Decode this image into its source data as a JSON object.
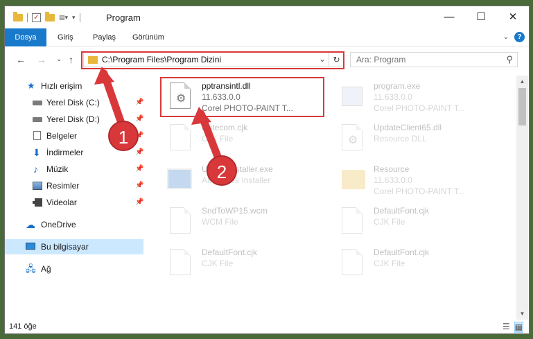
{
  "window": {
    "title": "Program",
    "minimize": "—",
    "maximize": "☐",
    "close": "✕"
  },
  "ribbon": {
    "tabs": [
      "Dosya",
      "Giriş",
      "Paylaş",
      "Görünüm"
    ],
    "expand": "⌄",
    "help": "?"
  },
  "nav": {
    "back": "←",
    "forward": "→",
    "recent": "⌄",
    "up": "↑",
    "path": "C:\\Program Files\\Program Dizini",
    "dropdown": "⌄",
    "refresh": "↻",
    "search_placeholder": "Ara: Program",
    "search_icon": "⚲"
  },
  "sidebar": {
    "items": [
      {
        "label": "Hızlı erişim",
        "icon": "star-icon",
        "pinned": false
      },
      {
        "label": "Yerel Disk (C:)",
        "icon": "disk-icon",
        "pinned": true
      },
      {
        "label": "Yerel Disk (D:)",
        "icon": "disk-icon",
        "pinned": true
      },
      {
        "label": "Belgeler",
        "icon": "documents-icon",
        "pinned": true
      },
      {
        "label": "İndirmeler",
        "icon": "download-icon",
        "pinned": true
      },
      {
        "label": "Müzik",
        "icon": "music-icon",
        "pinned": true
      },
      {
        "label": "Resimler",
        "icon": "pictures-icon",
        "pinned": true
      },
      {
        "label": "Videolar",
        "icon": "videos-icon",
        "pinned": true
      },
      {
        "label": "OneDrive",
        "icon": "onedrive-icon",
        "pinned": false
      },
      {
        "label": "Bu bilgisayar",
        "icon": "computer-icon",
        "pinned": false
      },
      {
        "label": "Ağ",
        "icon": "network-icon",
        "pinned": false
      }
    ],
    "pin_glyph": "📌"
  },
  "files": [
    {
      "name": "pptransintl.dll",
      "line2": "11.633.0.0",
      "line3": "Corel PHOTO-PAINT T...",
      "icon": "dll-icon"
    },
    {
      "name": "program.exe",
      "line2": "11.633.0.0",
      "line3": "Corel PHOTO-PAINT T...",
      "icon": "exe-icon"
    },
    {
      "name": "Ratecom.cjk",
      "line2": "CJK File",
      "line3": "",
      "icon": "file-icon"
    },
    {
      "name": "UpdateClient65.dll",
      "line2": "Resource DLL",
      "line3": "",
      "icon": "dll-icon"
    },
    {
      "name": "UpdateInstaller.exe",
      "line2": "Alternates Installer",
      "line3": "",
      "icon": "app-icon"
    },
    {
      "name": "Resource",
      "line2": "11.633.0.0",
      "line3": "Corel PHOTO-PAINT T...",
      "icon": "folder-icon"
    },
    {
      "name": "SndToWP15.wcm",
      "line2": "WCM File",
      "line3": "",
      "icon": "file-icon"
    },
    {
      "name": "DefaultFont.cjk",
      "line2": "CJK File",
      "line3": "",
      "icon": "file-icon"
    },
    {
      "name": "DefaultFont.cjk",
      "line2": "CJK File",
      "line3": "",
      "icon": "file-icon"
    },
    {
      "name": "DefaultFont.cjk",
      "line2": "CJK File",
      "line3": "",
      "icon": "file-icon"
    }
  ],
  "status": {
    "count": "141 öğe",
    "details_view": "☰",
    "tiles_view": "▦"
  },
  "annotations": {
    "badge1": "1",
    "badge2": "2",
    "color": "#d9383a"
  }
}
